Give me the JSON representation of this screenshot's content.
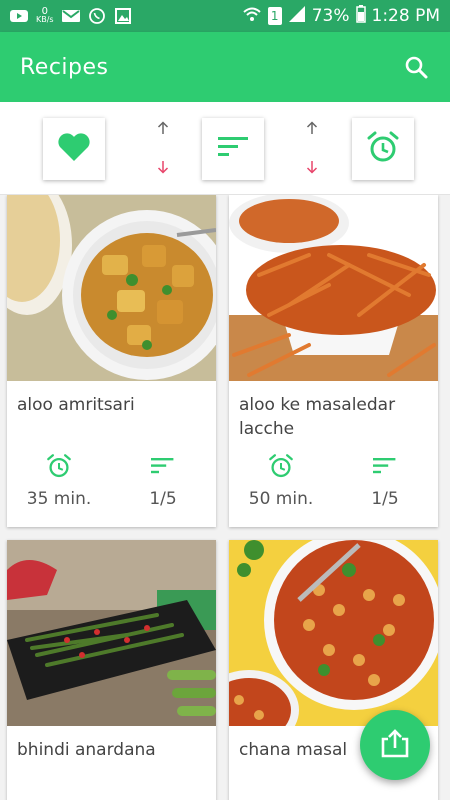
{
  "status_bar": {
    "network_speed": "0",
    "network_unit": "KB/s",
    "sim": "1",
    "battery": "73%",
    "time": "1:28 PM"
  },
  "app_bar": {
    "title": "Recipes",
    "search_icon": "search-icon"
  },
  "filter_bar": {
    "buttons": [
      {
        "name": "favorites",
        "icon": "heart-icon"
      },
      {
        "name": "difficulty",
        "icon": "sort-lines-icon"
      },
      {
        "name": "time",
        "icon": "alarm-clock-icon"
      }
    ],
    "arrow_up_color": "#666666",
    "arrow_down_color": "#e8456b"
  },
  "recipes": [
    {
      "title": "aloo amritsari",
      "time": "35 min.",
      "difficulty": "1/5"
    },
    {
      "title": "aloo ke masaledar lacche",
      "time": "50 min.",
      "difficulty": "1/5"
    },
    {
      "title": "bhindi anardana",
      "time": "",
      "difficulty": ""
    },
    {
      "title": "chana masal",
      "time": "",
      "difficulty": ""
    }
  ],
  "fab": {
    "icon": "share-icon"
  },
  "colors": {
    "primary": "#2ecc71",
    "status_bar": "#2aa866",
    "accent_icon": "#2ecc71"
  }
}
